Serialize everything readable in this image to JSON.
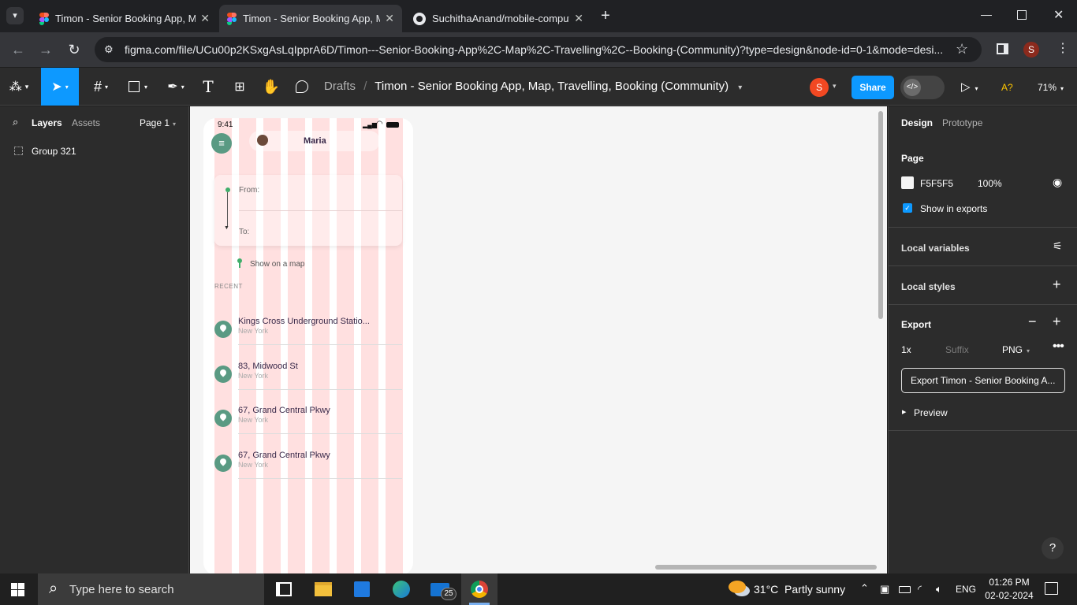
{
  "browser": {
    "tabs": [
      {
        "title": "Timon - Senior Booking App, M",
        "active": false,
        "icon": "figma-icon"
      },
      {
        "title": "Timon - Senior Booking App, M",
        "active": true,
        "icon": "figma-icon"
      },
      {
        "title": "SuchithaAnand/mobile-comput",
        "active": false,
        "icon": "github-icon"
      }
    ],
    "url": "figma.com/file/UCu00p2KSxgAsLqIpprA6D/Timon---Senior-Booking-App%2C-Map%2C-Travelling%2C--Booking-(Community)?type=design&node-id=0-1&mode=desi...",
    "profile_initial": "S"
  },
  "toolbar": {
    "breadcrumb_root": "Drafts",
    "file_name": "Timon - Senior Booking App, Map, Travelling, Booking (Community)",
    "avatar_initial": "S",
    "share_label": "Share",
    "a_indicator": "A?",
    "zoom": "71%"
  },
  "left_panel": {
    "tabs": [
      "Layers",
      "Assets"
    ],
    "page_selector": "Page 1",
    "layers": [
      {
        "name": "Group 321"
      }
    ]
  },
  "phone": {
    "time": "9:41",
    "user_name": "Maria",
    "from_label": "From:",
    "to_label": "To:",
    "show_on_map": "Show on a map",
    "recent_heading": "RECENT",
    "recent": [
      {
        "title": "Kings Cross Underground Statio...",
        "subtitle": "New York"
      },
      {
        "title": "83, Midwood St",
        "subtitle": "New York"
      },
      {
        "title": "67, Grand Central Pkwy",
        "subtitle": "New York"
      },
      {
        "title": "67, Grand Central Pkwy",
        "subtitle": "New York"
      }
    ]
  },
  "right_panel": {
    "tabs": [
      "Design",
      "Prototype"
    ],
    "page_heading": "Page",
    "page_color": "F5F5F5",
    "page_opacity": "100%",
    "show_in_exports": "Show in exports",
    "local_variables": "Local variables",
    "local_styles": "Local styles",
    "export_heading": "Export",
    "export_scale": "1x",
    "export_suffix_placeholder": "Suffix",
    "export_format": "PNG",
    "export_button": "Export Timon - Senior Booking A...",
    "preview": "Preview",
    "help": "?"
  },
  "taskbar": {
    "search_placeholder": "Type here to search",
    "mail_badge": "25",
    "weather": "31°C  Partly sunny",
    "language": "ENG",
    "time": "01:26 PM",
    "date": "02-02-2024"
  },
  "colors": {
    "accent_blue": "#0d99ff",
    "pin_green": "#5a9a83",
    "grid_pink": "#ffe0e0",
    "avatar_red": "#f24822"
  }
}
